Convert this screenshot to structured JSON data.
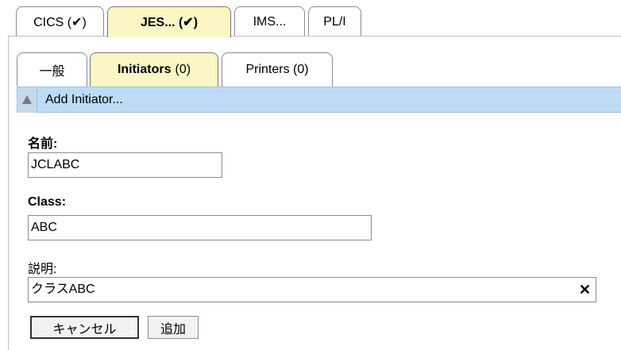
{
  "outer_tabs": [
    {
      "label": "CICS (✔)"
    },
    {
      "label": "JES... (✔)"
    },
    {
      "label": "IMS..."
    },
    {
      "label": "PL/I"
    }
  ],
  "inner_tabs": {
    "general": "一般",
    "initiators_label": "Initiators",
    "initiators_count": "(0)",
    "printers": "Printers (0)"
  },
  "add_initiator": "Add Initiator...",
  "form": {
    "name_label": "名前:",
    "name_value": "JCLABC",
    "class_label": "Class:",
    "class_value": "ABC",
    "description_label": "説明:",
    "description_value": "クラスABC"
  },
  "buttons": {
    "cancel": "キャンセル",
    "add": "追加"
  },
  "colors": {
    "active_tab": "#fcf6c4",
    "add_bar": "#bcdcf5"
  }
}
